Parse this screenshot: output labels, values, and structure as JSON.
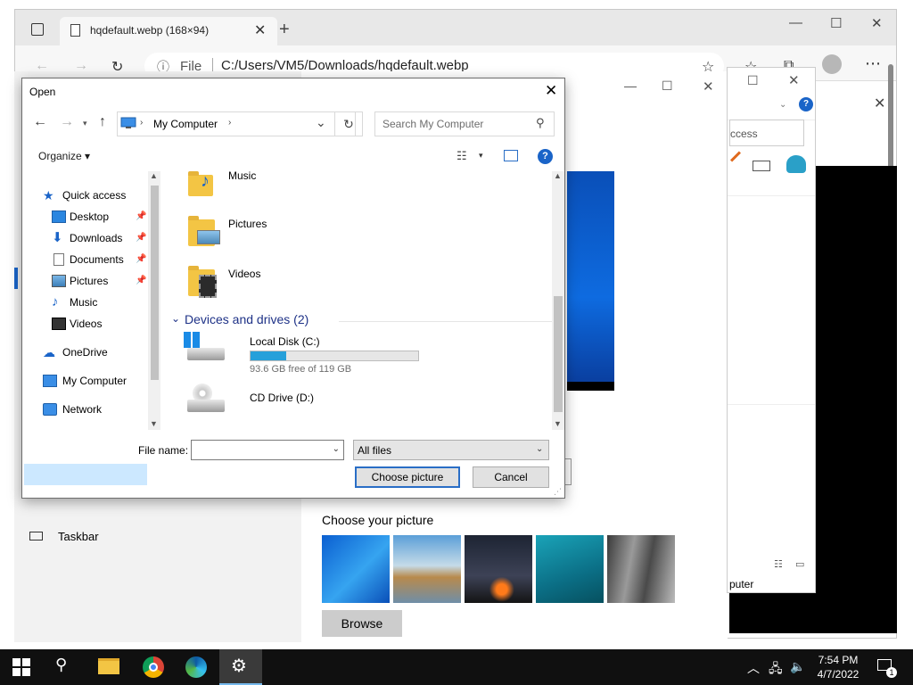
{
  "browser": {
    "tab_title": "hqdefault.webp (168×94)",
    "tab_close": "✕",
    "new_tab": "+",
    "address_scheme": "File",
    "address_url": "C:/Users/VM5/Downloads/hqdefault.webp"
  },
  "settings_page": {
    "taskbar_label": "Taskbar",
    "choose_title": "Choose your picture",
    "browse_label": "Browse"
  },
  "right_window": {
    "search_partial": "ccess",
    "bottom_partial": "puter"
  },
  "dialog": {
    "title": "Open",
    "path_location": "My Computer",
    "search_placeholder": "Search My Computer",
    "organize_label": "Organize ▾",
    "help_label": "?",
    "nav": [
      {
        "label": "Quick access"
      },
      {
        "label": "Desktop"
      },
      {
        "label": "Downloads"
      },
      {
        "label": "Documents"
      },
      {
        "label": "Pictures"
      },
      {
        "label": "Music"
      },
      {
        "label": "Videos"
      },
      {
        "label": "OneDrive"
      },
      {
        "label": "My Computer"
      },
      {
        "label": "Network"
      }
    ],
    "folders": [
      {
        "label": "Music"
      },
      {
        "label": "Pictures"
      },
      {
        "label": "Videos"
      }
    ],
    "devices_group": "Devices and drives (2)",
    "drives": [
      {
        "label": "Local Disk (C:)",
        "free_text": "93.6 GB free of 119 GB",
        "used_fraction": 0.213
      },
      {
        "label": "CD Drive (D:)"
      }
    ],
    "file_name_label": "File name:",
    "file_name_value": "",
    "file_type_value": "All files",
    "choose_button": "Choose picture",
    "cancel_button": "Cancel"
  },
  "taskbar": {
    "time": "7:54 PM",
    "date": "4/7/2022",
    "notification_count": "1"
  },
  "colors": {
    "accent": "#1a64c8",
    "selection": "#cce8ff",
    "disk_fill": "#26a0da",
    "group_header": "#1e3287"
  }
}
